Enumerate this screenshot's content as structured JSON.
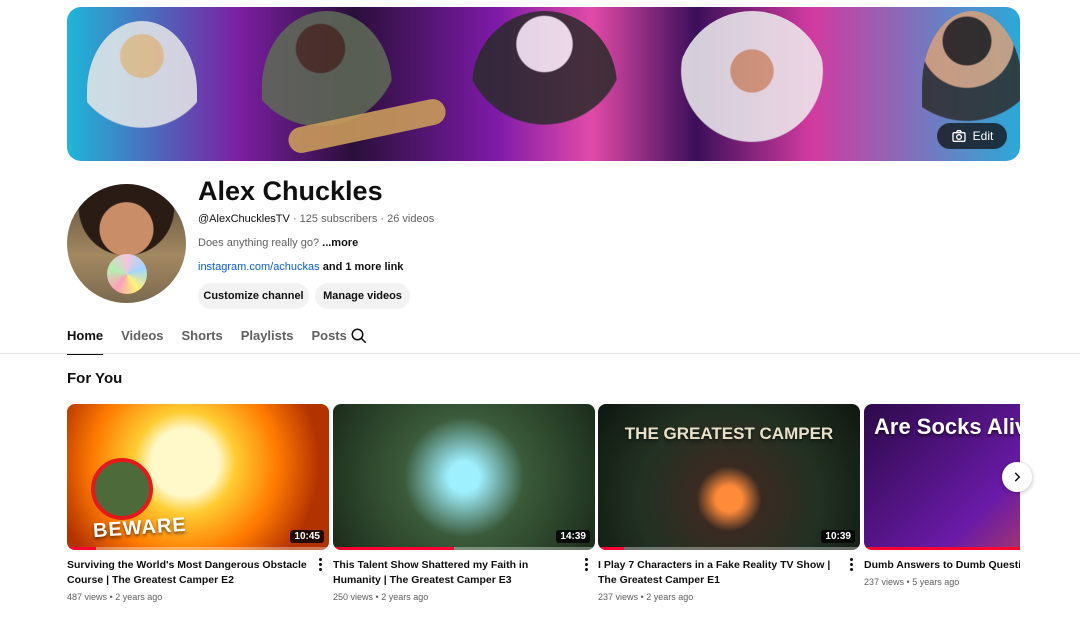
{
  "banner": {
    "edit_label": "Edit",
    "icons": {
      "edit": "camera-icon"
    }
  },
  "channel": {
    "name": "Alex Chuckles",
    "handle": "@AlexChucklesTV",
    "subscribers": "125 subscribers",
    "videos": "26 videos",
    "description": "Does anything really go?",
    "more_label": "...more",
    "link": "instagram.com/achuckas",
    "more_links": "and 1 more link"
  },
  "buttons": {
    "customize": "Customize channel",
    "manage": "Manage videos"
  },
  "tabs": [
    {
      "label": "Home",
      "active": true
    },
    {
      "label": "Videos"
    },
    {
      "label": "Shorts"
    },
    {
      "label": "Playlists"
    },
    {
      "label": "Posts"
    }
  ],
  "section": {
    "title": "For You"
  },
  "videos": [
    {
      "title": "Surviving the World's Most Dangerous Obstacle Course | The Greatest Camper E2",
      "duration": "10:45",
      "views": "487 views",
      "age": "2 years ago",
      "thumb_text": "BEWARE",
      "progress": 0.11
    },
    {
      "title": "This Talent Show Shattered my Faith in Humanity | The Greatest Camper E3",
      "duration": "14:39",
      "views": "250 views",
      "age": "2 years ago",
      "thumb_text": "",
      "progress": 0.46
    },
    {
      "title": "I Play 7 Characters in a Fake Reality TV Show | The Greatest Camper E1",
      "duration": "10:39",
      "views": "237 views",
      "age": "2 years ago",
      "thumb_text": "THE GREATEST CAMPER",
      "progress": 0.1
    },
    {
      "title": "Dumb Answers to Dumb Questions",
      "duration": "",
      "views": "237 views",
      "age": "5 years ago",
      "thumb_text": "Are Socks Alive?",
      "progress": 1.0
    }
  ]
}
